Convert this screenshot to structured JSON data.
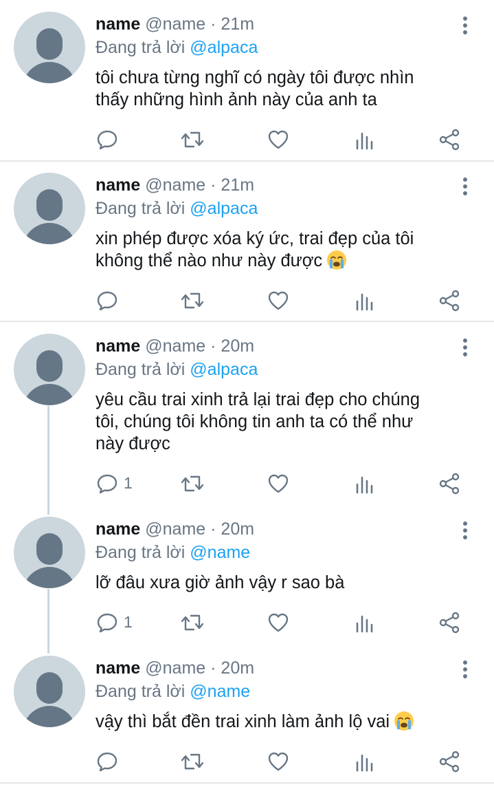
{
  "tweets": [
    {
      "name": "name",
      "handle": "@name",
      "time": "· 21m",
      "reply_prefix": "Đang trả lời",
      "reply_to": "@alpaca",
      "text_lines": [
        "tôi chưa từng nghĩ có ngày tôi được nhìn",
        "thấy những hình ảnh này của anh ta"
      ],
      "reply_count": ""
    },
    {
      "name": "name",
      "handle": "@name",
      "time": "· 21m",
      "reply_prefix": "Đang trả lời",
      "reply_to": "@alpaca",
      "text_lines": [
        "xin phép được xóa ký ức, trai đẹp của tôi",
        "không thể nào như này được"
      ],
      "emoji": "loudly-crying-face",
      "reply_count": ""
    },
    {
      "name": "name",
      "handle": "@name",
      "time": "· 20m",
      "reply_prefix": "Đang trả lời",
      "reply_to": "@alpaca",
      "text_lines": [
        "yêu cầu trai xinh trả lại trai đẹp cho chúng",
        "tôi, chúng tôi không tin anh ta có thể như",
        "này được"
      ],
      "reply_count": "1"
    },
    {
      "name": "name",
      "handle": "@name",
      "time": "· 20m",
      "reply_prefix": "Đang trả lời",
      "reply_to": "@name",
      "text_lines": [
        "lỡ đâu xưa giờ ảnh vậy r sao bà"
      ],
      "reply_count": "1"
    },
    {
      "name": "name",
      "handle": "@name",
      "time": "· 20m",
      "reply_prefix": "Đang trả lời",
      "reply_to": "@name",
      "text_lines": [
        "vậy thì bắt đền trai xinh làm ảnh lộ vai"
      ],
      "emoji": "loudly-crying-face",
      "reply_count": ""
    }
  ],
  "icons": [
    "reply-icon",
    "retweet-icon",
    "like-icon",
    "analytics-icon",
    "share-icon",
    "more-icon"
  ],
  "colors": {
    "mention": "#1da1f2",
    "secondary": "#687684",
    "primary_text": "#14171a",
    "avatar_bg": "#ccd6dd",
    "avatar_fg": "#657786"
  }
}
